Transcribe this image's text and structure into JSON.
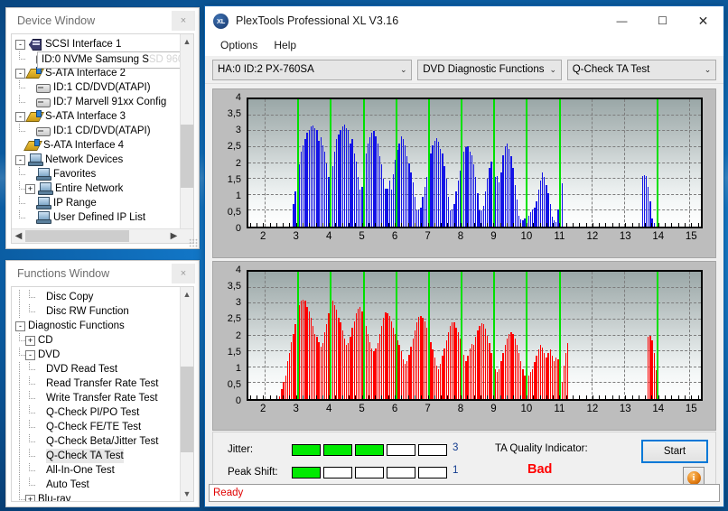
{
  "device_window": {
    "title": "Device Window",
    "close_label": "×",
    "tooltip": "ID:0  NVMe     Samsung SSD 960",
    "tooltip_visible_text": "ID:0  NVMe     Samsung S",
    "tooltip_faded_text": "SD 960",
    "tree": [
      {
        "label": "SCSI Interface 1",
        "depth": 0,
        "icon": "scsi-icon",
        "expander": "-"
      },
      {
        "label": "ID:0  NVMe     Samsung SSD 960",
        "depth": 1,
        "icon": "drive-icon",
        "expander": ""
      },
      {
        "label": "S-ATA Interface 2",
        "depth": 0,
        "icon": "sata-icon",
        "expander": "-"
      },
      {
        "label": "ID:1  CD/DVD(ATAPI)",
        "depth": 1,
        "icon": "drive-icon",
        "expander": ""
      },
      {
        "label": "ID:7  Marvell 91xx Config",
        "depth": 1,
        "icon": "drive-icon",
        "expander": ""
      },
      {
        "label": "S-ATA Interface 3",
        "depth": 0,
        "icon": "sata-icon",
        "expander": "-"
      },
      {
        "label": "ID:1  CD/DVD(ATAPI)",
        "depth": 1,
        "icon": "drive-icon",
        "expander": ""
      },
      {
        "label": "S-ATA Interface 4",
        "depth": 0,
        "icon": "sata-icon",
        "expander": ""
      },
      {
        "label": "Network Devices",
        "depth": 0,
        "icon": "network-icon",
        "expander": "-"
      },
      {
        "label": "Favorites",
        "depth": 1,
        "icon": "network-icon",
        "expander": ""
      },
      {
        "label": "Entire Network",
        "depth": 1,
        "icon": "network-icon",
        "expander": "+"
      },
      {
        "label": "IP Range",
        "depth": 1,
        "icon": "network-icon",
        "expander": ""
      },
      {
        "label": "User Defined IP List",
        "depth": 1,
        "icon": "network-icon",
        "expander": ""
      }
    ]
  },
  "functions_window": {
    "title": "Functions Window",
    "close_label": "×",
    "tree": [
      {
        "label": "Disc Copy",
        "depth": 2,
        "expander": "",
        "selected": false
      },
      {
        "label": "Disc RW Function",
        "depth": 2,
        "expander": "",
        "selected": false
      },
      {
        "label": "Diagnostic Functions",
        "depth": 0,
        "expander": "-",
        "selected": false
      },
      {
        "label": "CD",
        "depth": 1,
        "expander": "+",
        "selected": false
      },
      {
        "label": "DVD",
        "depth": 1,
        "expander": "-",
        "selected": false
      },
      {
        "label": "DVD Read Test",
        "depth": 2,
        "expander": "",
        "selected": false
      },
      {
        "label": "Read Transfer Rate Test",
        "depth": 2,
        "expander": "",
        "selected": false
      },
      {
        "label": "Write Transfer Rate Test",
        "depth": 2,
        "expander": "",
        "selected": false
      },
      {
        "label": "Q-Check PI/PO Test",
        "depth": 2,
        "expander": "",
        "selected": false
      },
      {
        "label": "Q-Check FE/TE Test",
        "depth": 2,
        "expander": "",
        "selected": false
      },
      {
        "label": "Q-Check Beta/Jitter Test",
        "depth": 2,
        "expander": "",
        "selected": false
      },
      {
        "label": "Q-Check TA Test",
        "depth": 2,
        "expander": "",
        "selected": true
      },
      {
        "label": "All-In-One Test",
        "depth": 2,
        "expander": "",
        "selected": false
      },
      {
        "label": "Auto Test",
        "depth": 2,
        "expander": "",
        "selected": false
      },
      {
        "label": "Blu-ray",
        "depth": 1,
        "expander": "+",
        "selected": false
      }
    ]
  },
  "app": {
    "title": "PlexTools Professional XL V3.16",
    "icon_text": "XL",
    "minimize": "—",
    "maximize": "☐",
    "close": "✕",
    "menu": [
      "Options",
      "Help"
    ],
    "combos": {
      "drive": "HA:0 ID:2  PX-760SA",
      "function": "DVD Diagnostic Functions",
      "test": "Q-Check TA Test",
      "chevron": "⌄"
    },
    "status": "Ready"
  },
  "results": {
    "jitter_label": "Jitter:",
    "jitter_value": "3",
    "jitter_filled": 3,
    "jitter_total": 5,
    "peak_shift_label": "Peak Shift:",
    "peak_shift_value": "1",
    "peak_shift_filled": 1,
    "peak_shift_total": 5,
    "ta_label": "TA Quality Indicator:",
    "ta_value": "Bad",
    "ta_color": "#ff0000",
    "start_label": "Start",
    "info_label": "i"
  },
  "chart_data": [
    {
      "type": "bar",
      "name": "TA Test - upper plot",
      "title": "",
      "xlabel": "",
      "ylabel": "",
      "color": "#1414e6",
      "xlim": [
        1.5,
        15.35
      ],
      "ylim": [
        0,
        4
      ],
      "yticks": [
        0,
        0.5,
        1,
        1.5,
        2,
        2.5,
        3,
        3.5,
        4
      ],
      "ytick_labels": [
        "0",
        "0,5",
        "1",
        "1,5",
        "2",
        "2,5",
        "3",
        "3,5",
        "4"
      ],
      "xticks": [
        2,
        3,
        4,
        5,
        6,
        7,
        8,
        9,
        10,
        11,
        12,
        13,
        14,
        15
      ],
      "xtick_labels": [
        "2",
        "3",
        "4",
        "5",
        "6",
        "7",
        "8",
        "9",
        "10",
        "11",
        "12",
        "13",
        "14",
        "15"
      ],
      "grid": true,
      "markers": [
        3,
        4,
        5,
        6,
        7,
        8,
        9,
        10,
        11,
        14
      ],
      "x": [
        2.88,
        2.94,
        3.0,
        3.06,
        3.12,
        3.18,
        3.24,
        3.3,
        3.36,
        3.42,
        3.48,
        3.54,
        3.6,
        3.66,
        3.72,
        3.78,
        3.84,
        3.9,
        3.96,
        4.02,
        4.08,
        4.14,
        4.2,
        4.26,
        4.32,
        4.38,
        4.44,
        4.5,
        4.56,
        4.62,
        4.68,
        4.74,
        4.8,
        4.86,
        4.92,
        4.98,
        5.04,
        5.1,
        5.16,
        5.22,
        5.28,
        5.34,
        5.4,
        5.46,
        5.52,
        5.58,
        5.64,
        5.7,
        5.76,
        5.82,
        5.88,
        5.94,
        6.0,
        6.06,
        6.12,
        6.18,
        6.24,
        6.3,
        6.36,
        6.42,
        6.48,
        6.54,
        6.6,
        6.66,
        6.72,
        6.78,
        6.84,
        6.9,
        6.96,
        7.02,
        7.08,
        7.14,
        7.2,
        7.26,
        7.32,
        7.38,
        7.44,
        7.5,
        7.56,
        7.62,
        7.68,
        7.74,
        7.8,
        7.86,
        7.92,
        7.98,
        8.04,
        8.1,
        8.16,
        8.22,
        8.28,
        8.34,
        8.4,
        8.46,
        8.52,
        8.58,
        8.64,
        8.7,
        8.76,
        8.82,
        8.88,
        8.94,
        9.0,
        9.06,
        9.12,
        9.18,
        9.24,
        9.3,
        9.36,
        9.42,
        9.48,
        9.54,
        9.6,
        9.66,
        9.72,
        9.78,
        9.84,
        9.9,
        9.96,
        10.02,
        10.08,
        10.14,
        10.2,
        10.26,
        10.32,
        10.38,
        10.44,
        10.5,
        10.56,
        10.62,
        10.68,
        10.74,
        10.8,
        10.86,
        10.92,
        10.98,
        11.04,
        11.1,
        13.56,
        13.62,
        13.68,
        13.74,
        13.8,
        13.86,
        13.92,
        13.98,
        14.04,
        14.1
      ],
      "values": [
        0.72,
        1.1,
        2.1,
        1.95,
        2.35,
        2.55,
        2.75,
        2.95,
        3.05,
        3.15,
        3.18,
        3.1,
        3.05,
        2.7,
        2.8,
        2.55,
        2.35,
        2.0,
        1.55,
        1.25,
        1.9,
        2.35,
        2.75,
        2.9,
        3.05,
        3.15,
        3.2,
        3.1,
        3.05,
        2.6,
        2.75,
        2.3,
        2.05,
        1.55,
        1.15,
        1.25,
        1.85,
        2.3,
        2.6,
        2.8,
        2.95,
        3.0,
        2.85,
        2.6,
        2.2,
        1.95,
        1.5,
        1.2,
        1.2,
        1.45,
        1.15,
        1.65,
        2.1,
        2.4,
        2.6,
        2.85,
        2.75,
        2.55,
        2.2,
        2.0,
        1.7,
        1.4,
        0.95,
        0.5,
        0.55,
        0.6,
        0.95,
        1.25,
        1.55,
        1.85,
        2.3,
        2.55,
        2.7,
        2.78,
        2.68,
        2.45,
        2.3,
        1.9,
        1.5,
        0.95,
        0.5,
        0.55,
        0.7,
        1.1,
        1.45,
        1.75,
        2.05,
        2.35,
        2.5,
        2.52,
        2.35,
        2.25,
        1.95,
        1.55,
        1.05,
        0.52,
        0.52,
        0.65,
        1.1,
        1.5,
        1.85,
        2.05,
        2.0,
        1.55,
        1.6,
        1.4,
        1.7,
        2.25,
        2.52,
        2.6,
        2.45,
        2.2,
        1.85,
        1.3,
        0.85,
        0.35,
        0.22,
        0.2,
        0.25,
        0.3,
        0.35,
        0.45,
        0.55,
        0.6,
        0.8,
        1.15,
        1.45,
        1.7,
        1.55,
        1.3,
        1.05,
        0.7,
        0.3,
        0.2,
        0.15,
        0.55,
        0.9,
        1.35,
        1.6,
        1.62,
        1.6,
        1.25,
        0.8,
        0.25,
        0.12
      ]
    },
    {
      "type": "bar",
      "name": "TA Test - lower plot",
      "title": "",
      "xlabel": "",
      "ylabel": "",
      "color": "#ff0000",
      "xlim": [
        1.5,
        15.35
      ],
      "ylim": [
        0,
        4
      ],
      "yticks": [
        0,
        0.5,
        1,
        1.5,
        2,
        2.5,
        3,
        3.5,
        4
      ],
      "ytick_labels": [
        "0",
        "0,5",
        "1",
        "1,5",
        "2",
        "2,5",
        "3",
        "3,5",
        "4"
      ],
      "xticks": [
        2,
        3,
        4,
        5,
        6,
        7,
        8,
        9,
        10,
        11,
        12,
        13,
        14,
        15
      ],
      "xtick_labels": [
        "2",
        "3",
        "4",
        "5",
        "6",
        "7",
        "8",
        "9",
        "10",
        "11",
        "12",
        "13",
        "14",
        "15"
      ],
      "grid": true,
      "markers": [
        3,
        4,
        5,
        6,
        7,
        8,
        9,
        10,
        11,
        14
      ],
      "x": [
        2.46,
        2.52,
        2.58,
        2.64,
        2.7,
        2.76,
        2.82,
        2.88,
        2.94,
        3.0,
        3.06,
        3.12,
        3.18,
        3.24,
        3.3,
        3.36,
        3.42,
        3.48,
        3.54,
        3.6,
        3.66,
        3.72,
        3.78,
        3.84,
        3.9,
        3.96,
        4.02,
        4.08,
        4.14,
        4.2,
        4.26,
        4.32,
        4.38,
        4.44,
        4.5,
        4.56,
        4.62,
        4.68,
        4.74,
        4.8,
        4.86,
        4.92,
        4.98,
        5.04,
        5.1,
        5.16,
        5.22,
        5.28,
        5.34,
        5.4,
        5.46,
        5.52,
        5.58,
        5.64,
        5.7,
        5.76,
        5.82,
        5.88,
        5.94,
        6.0,
        6.06,
        6.12,
        6.18,
        6.24,
        6.3,
        6.36,
        6.42,
        6.48,
        6.54,
        6.6,
        6.66,
        6.72,
        6.78,
        6.84,
        6.9,
        6.96,
        7.02,
        7.08,
        7.14,
        7.2,
        7.26,
        7.32,
        7.38,
        7.44,
        7.5,
        7.56,
        7.62,
        7.68,
        7.74,
        7.8,
        7.86,
        7.92,
        7.98,
        8.04,
        8.1,
        8.16,
        8.22,
        8.28,
        8.34,
        8.4,
        8.46,
        8.52,
        8.58,
        8.64,
        8.7,
        8.76,
        8.82,
        8.88,
        8.94,
        9.0,
        9.06,
        9.12,
        9.18,
        9.24,
        9.3,
        9.36,
        9.42,
        9.48,
        9.54,
        9.6,
        9.66,
        9.72,
        9.78,
        9.84,
        9.9,
        9.96,
        10.02,
        10.08,
        10.14,
        10.2,
        10.26,
        10.32,
        10.38,
        10.44,
        10.5,
        10.56,
        10.62,
        10.68,
        10.74,
        10.8,
        10.86,
        10.92,
        10.98,
        11.04,
        11.1,
        11.16,
        11.22,
        11.28,
        13.74,
        13.8,
        13.86,
        13.92,
        13.98,
        14.04,
        14.1,
        14.16
      ],
      "values": [
        0.08,
        0.3,
        0.55,
        0.75,
        1.2,
        1.45,
        1.8,
        2.05,
        2.35,
        2.6,
        2.95,
        3.1,
        3.12,
        3.1,
        2.9,
        2.75,
        2.55,
        2.3,
        2.05,
        1.95,
        1.8,
        1.65,
        1.75,
        2.1,
        2.35,
        2.7,
        3.05,
        3.08,
        2.95,
        2.8,
        2.55,
        2.4,
        2.15,
        1.9,
        1.7,
        1.75,
        1.95,
        2.25,
        2.45,
        2.7,
        2.85,
        2.9,
        2.75,
        2.55,
        2.3,
        2.05,
        1.8,
        1.6,
        1.5,
        1.6,
        1.75,
        2.05,
        2.3,
        2.55,
        2.72,
        2.7,
        2.6,
        2.45,
        2.25,
        2.05,
        1.85,
        1.7,
        1.5,
        1.25,
        1.1,
        1.2,
        1.4,
        1.65,
        1.9,
        2.15,
        2.4,
        2.58,
        2.62,
        2.55,
        2.45,
        2.25,
        2.05,
        1.8,
        1.55,
        1.3,
        1.05,
        0.95,
        1.1,
        1.35,
        1.6,
        1.85,
        2.1,
        2.3,
        2.42,
        2.4,
        2.25,
        2.1,
        1.9,
        1.65,
        1.4,
        1.2,
        1.35,
        1.6,
        1.72,
        1.7,
        1.95,
        2.15,
        2.3,
        2.38,
        2.35,
        2.2,
        2.0,
        1.75,
        1.45,
        1.15,
        0.95,
        0.85,
        0.95,
        1.2,
        1.45,
        1.7,
        1.9,
        2.05,
        2.1,
        2.05,
        1.9,
        1.7,
        1.45,
        1.2,
        0.95,
        0.75,
        0.72,
        0.75,
        0.85,
        0.95,
        1.15,
        1.35,
        1.55,
        1.7,
        1.62,
        1.45,
        1.3,
        1.45,
        1.55,
        1.35,
        1.2,
        1.3,
        1.25,
        0.95,
        0.55,
        1.05,
        1.45,
        1.75,
        1.95,
        2.0,
        1.85,
        1.45,
        0.9,
        0.35
      ]
    }
  ]
}
